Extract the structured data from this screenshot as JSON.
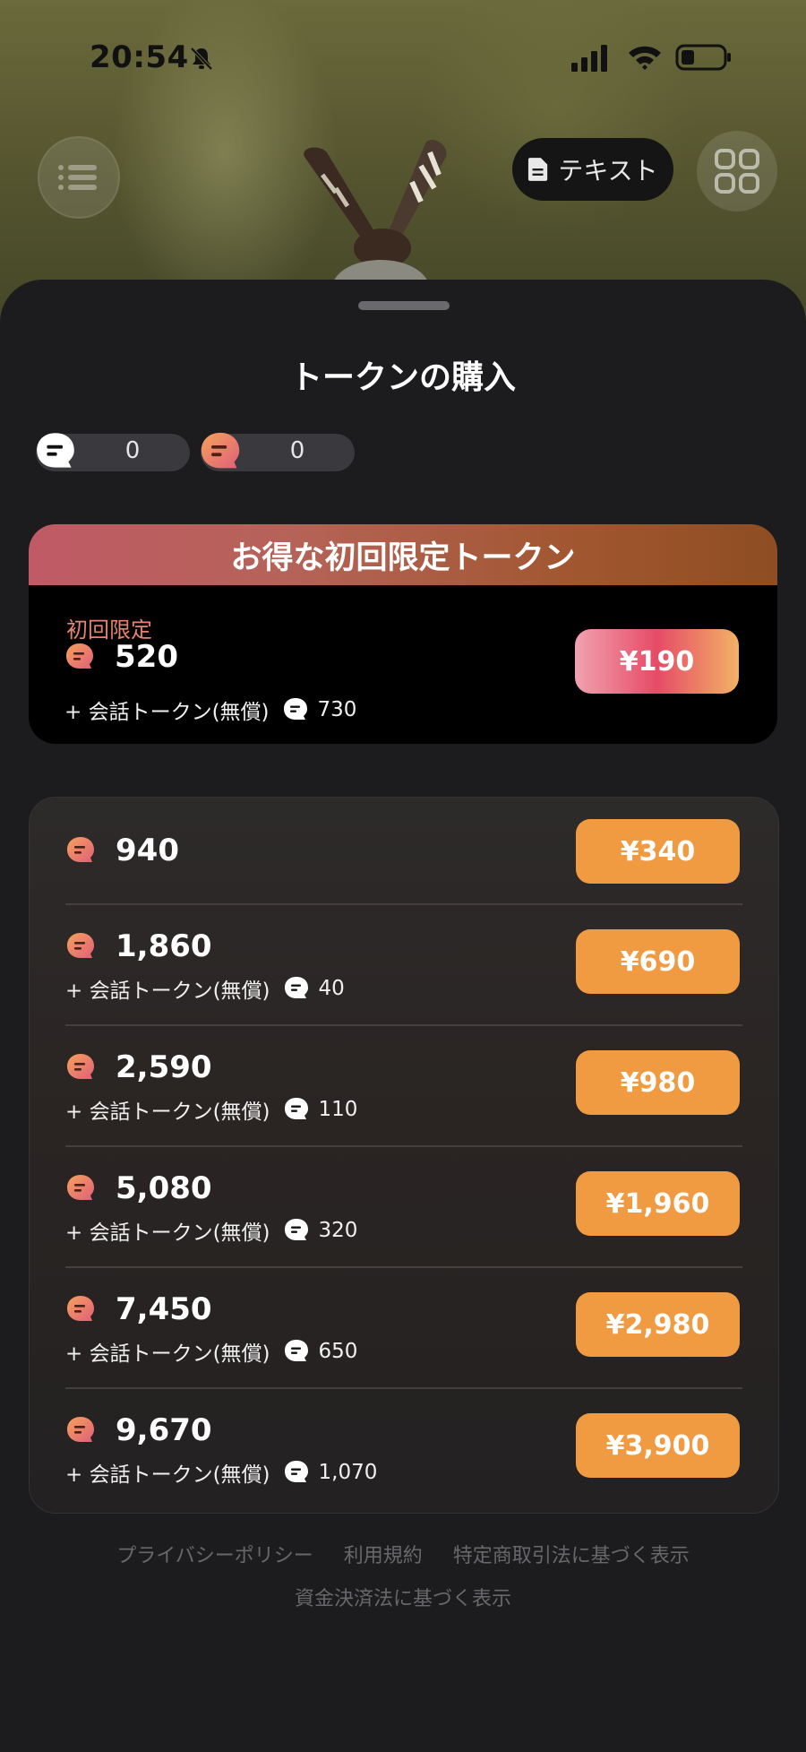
{
  "status_bar": {
    "time": "20:54"
  },
  "top_bar": {
    "text_button_label": "テキスト"
  },
  "sheet": {
    "title": "トークンの購入",
    "balances": [
      {
        "type": "free",
        "value": "0"
      },
      {
        "type": "paid",
        "value": "0"
      }
    ],
    "promo": {
      "header": "お得な初回限定トークン",
      "label": "初回限定",
      "amount": "520",
      "bonus_label": "+ 会話トークン(無償)",
      "bonus_amount": "730",
      "price": "¥190"
    },
    "packages": [
      {
        "amount": "940",
        "bonus_label": "",
        "bonus_amount": "",
        "price": "¥340"
      },
      {
        "amount": "1,860",
        "bonus_label": "+ 会話トークン(無償)",
        "bonus_amount": "40",
        "price": "¥690"
      },
      {
        "amount": "2,590",
        "bonus_label": "+ 会話トークン(無償)",
        "bonus_amount": "110",
        "price": "¥980"
      },
      {
        "amount": "5,080",
        "bonus_label": "+ 会話トークン(無償)",
        "bonus_amount": "320",
        "price": "¥1,960"
      },
      {
        "amount": "7,450",
        "bonus_label": "+ 会話トークン(無償)",
        "bonus_amount": "650",
        "price": "¥2,980"
      },
      {
        "amount": "9,670",
        "bonus_label": "+ 会話トークン(無償)",
        "bonus_amount": "1,070",
        "price": "¥3,900"
      }
    ],
    "footer": {
      "privacy": "プライバシーポリシー",
      "terms": "利用規約",
      "commerce": "特定商取引法に基づく表示",
      "payment": "資金決済法に基づく表示"
    }
  },
  "colors": {
    "accent_orange": "#f09a42",
    "token_paid_gradient": [
      "#f6a15a",
      "#e0607a"
    ],
    "promo_label": "#e7836b"
  },
  "icons": [
    "bell-slash-icon",
    "cellular-signal-icon",
    "wifi-icon",
    "battery-icon",
    "menu-icon",
    "document-icon",
    "grid-icon",
    "chat-bubble-icon",
    "token-icon"
  ]
}
